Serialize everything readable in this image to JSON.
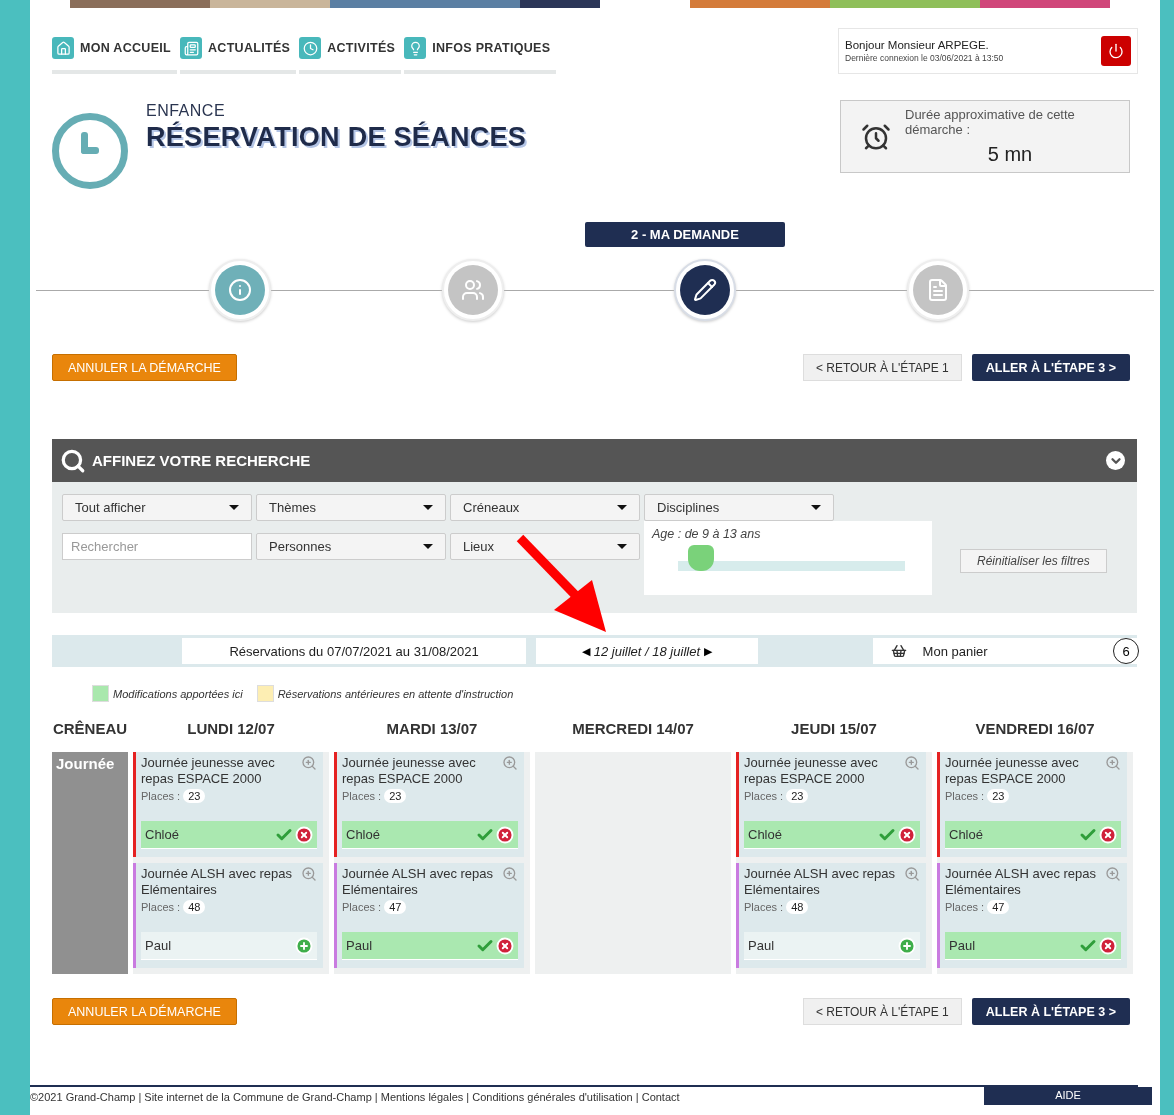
{
  "nav": [
    {
      "label": "MON ACCUEIL"
    },
    {
      "label": "ACTUALITÉS"
    },
    {
      "label": "ACTIVITÉS"
    },
    {
      "label": "INFOS PRATIQUES"
    }
  ],
  "user": {
    "greeting": "Bonjour Monsieur ARPEGE.",
    "last_login": "Dernière connexion le 03/06/2021 à 13:50"
  },
  "header": {
    "category": "ENFANCE",
    "title": "RÉSERVATION DE SÉANCES"
  },
  "duration": {
    "label": "Durée approximative de cette démarche :",
    "value": "5 mn"
  },
  "steps": {
    "current_label": "2 - MA DEMANDE",
    "items": [
      {
        "completed": true,
        "selected": false
      },
      {
        "completed": false,
        "selected": false
      },
      {
        "completed": false,
        "selected": true
      },
      {
        "completed": false,
        "selected": false
      }
    ]
  },
  "actions_top": {
    "cancel": "ANNULER LA DÉMARCHE",
    "back": "< RETOUR À L'ÉTAPE 1",
    "next": "ALLER À L'ÉTAPE 3 >"
  },
  "filters": {
    "title": "AFFINEZ VOTRE RECHERCHE",
    "row_1": [
      "Tout afficher",
      "Thèmes",
      "Créneaux",
      "Disciplines"
    ],
    "search_placeholder": "Rechercher",
    "row_2": [
      "Personnes",
      "Lieux"
    ],
    "age_label": "Age : de 9 à 13 ans",
    "level": 0.1,
    "reset": "Réinitialiser les filtres"
  },
  "week_bar": {
    "range": "Réservations du 07/07/2021 au 31/08/2021",
    "prev": "◀",
    "week": "12 juillet / 18 juillet",
    "next": "▶",
    "basket": "Mon panier",
    "basket_count": "6"
  },
  "annotation_arrow": true,
  "legend": [
    {
      "label": "Modifications apportées ici",
      "color": "#a9e8ad"
    },
    {
      "label": "Réservations antérieures en attente d'instruction",
      "color": "#fdeeb3"
    }
  ],
  "schedule": {
    "slot_header": "CRÊNEAU",
    "slot": "Journée",
    "days": [
      {
        "label": "LUNDI 12/07",
        "sessions": [
          {
            "title": "Journée jeunesse avec repas ESPACE 2000",
            "places_label": "Places :",
            "places": "23",
            "color": "#e52222",
            "child": "Chloé",
            "booked": true
          },
          {
            "title": "Journée ALSH avec repas Elémentaires",
            "places_label": "Places :",
            "places": "48",
            "color": "#c97be0",
            "child": "Paul",
            "booked": false
          }
        ]
      },
      {
        "label": "MARDI 13/07",
        "sessions": [
          {
            "title": "Journée jeunesse avec repas ESPACE 2000",
            "places_label": "Places :",
            "places": "23",
            "color": "#e52222",
            "child": "Chloé",
            "booked": true
          },
          {
            "title": "Journée ALSH avec repas Elémentaires",
            "places_label": "Places :",
            "places": "47",
            "color": "#c97be0",
            "child": "Paul",
            "booked": true
          }
        ]
      },
      {
        "label": "MERCREDI 14/07"
      },
      {
        "label": "JEUDI 15/07",
        "sessions": [
          {
            "title": "Journée jeunesse avec repas ESPACE 2000",
            "places_label": "Places :",
            "places": "23",
            "color": "#e52222",
            "child": "Chloé",
            "booked": true
          },
          {
            "title": "Journée ALSH avec repas Elémentaires",
            "places_label": "Places :",
            "places": "48",
            "color": "#c97be0",
            "child": "Paul",
            "booked": false
          }
        ]
      },
      {
        "label": "VENDREDI 16/07",
        "sessions": [
          {
            "title": "Journée jeunesse avec repas ESPACE 2000",
            "places_label": "Places :",
            "places": "23",
            "color": "#e52222",
            "child": "Chloé",
            "booked": true
          },
          {
            "title": "Journée ALSH avec repas Elémentaires",
            "places_label": "Places :",
            "places": "47",
            "color": "#c97be0",
            "child": "Paul",
            "booked": true
          }
        ]
      }
    ]
  },
  "actions_bottom": {
    "cancel": "ANNULER LA DÉMARCHE",
    "back": "< RETOUR À L'ÉTAPE 1",
    "next": "ALLER À L'ÉTAPE 3 >"
  },
  "footer": {
    "text": "©2021 Grand-Champ | Site internet de la Commune de Grand-Champ | Mentions légales | Conditions générales d'utilisation | Contact",
    "help": "AIDE"
  }
}
